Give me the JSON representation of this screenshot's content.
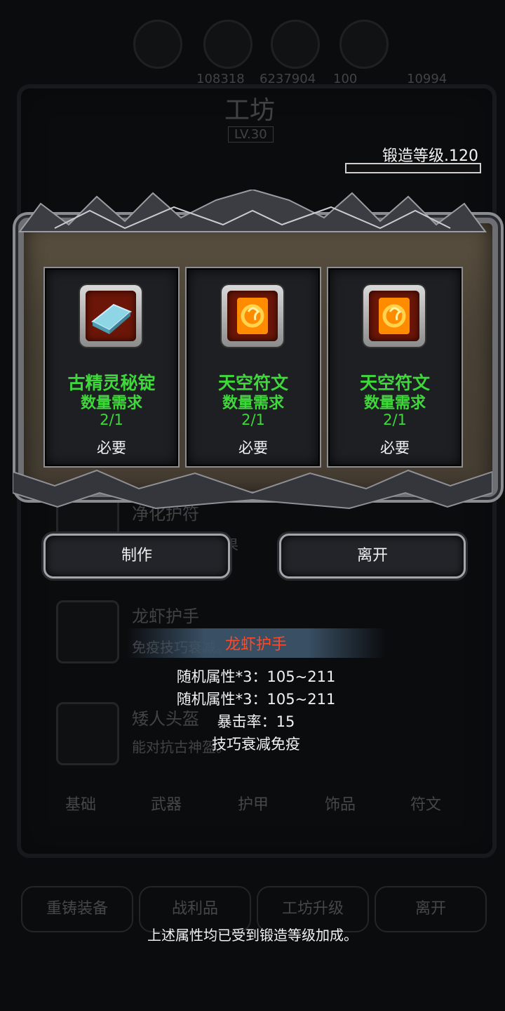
{
  "background": {
    "resources": [
      "108318",
      "6237904",
      "100",
      "10994"
    ],
    "title": "工坊",
    "level_badge": "LV.30",
    "items": [
      {
        "name": "净化护符",
        "desc": "免疫效果"
      },
      {
        "name": "龙虾护手",
        "desc": "免疫技巧衰减。"
      },
      {
        "name": "矮人头盔",
        "desc": "能对抗古神盔。"
      }
    ],
    "tabs": [
      "基础",
      "武器",
      "护甲",
      "饰品",
      "符文"
    ],
    "bottom_buttons": [
      "重铸装备",
      "战利品",
      "工坊升级",
      "离开"
    ]
  },
  "forge": {
    "level_label": "锻造等级.120",
    "progress": 0.0
  },
  "dialog": {
    "materials": [
      {
        "name": "古精灵秘锭",
        "requirement": "数量需求",
        "count": "2/1",
        "required": "必要",
        "icon": "silver-ingot-icon"
      },
      {
        "name": "天空符文",
        "requirement": "数量需求",
        "count": "2/1",
        "required": "必要",
        "icon": "fire-rune-icon"
      },
      {
        "name": "天空符文",
        "requirement": "数量需求",
        "count": "2/1",
        "required": "必要",
        "icon": "fire-rune-icon"
      }
    ],
    "craft_label": "制作",
    "leave_label": "离开"
  },
  "tooltip": {
    "title": "龙虾护手",
    "lines": [
      "随机属性*3：105~211",
      "随机属性*3：105~211",
      "暴击率：15",
      "技巧衰减免疫"
    ]
  },
  "footer_note": "上述属性均已受到锻造等级加成。",
  "colors": {
    "material_text": "#3fd83a",
    "tooltip_title": "#ff4a2a",
    "background": "#0b0c0e"
  }
}
